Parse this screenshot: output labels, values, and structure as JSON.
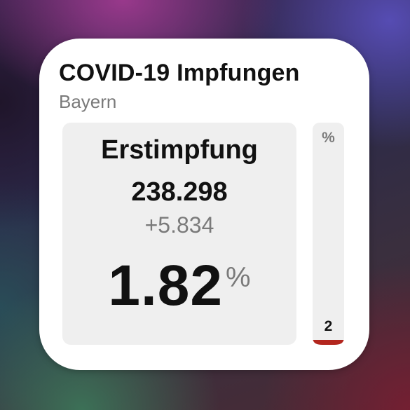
{
  "widget": {
    "title": "COVID-19 Impfungen",
    "region": "Bayern",
    "dose_label": "Erstimpfung",
    "total": "238.298",
    "delta": "+5.834",
    "percent": "1.82",
    "percent_unit": "%",
    "bar": {
      "unit": "%",
      "value_label": "2",
      "fill_fraction": 0.0182,
      "fill_color": "#b3261e"
    }
  }
}
